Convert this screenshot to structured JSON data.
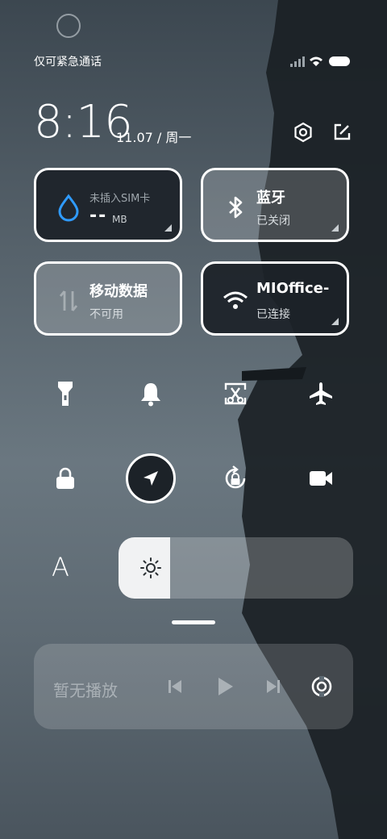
{
  "status_bar": {
    "carrier_text": "仅可紧急通话"
  },
  "header": {
    "time": "8:16",
    "date": "11.07 / 周一"
  },
  "tiles": [
    {
      "title": "未插入SIM卡",
      "value": "--",
      "unit": "MB"
    },
    {
      "title": "蓝牙",
      "subtitle": "已关闭"
    },
    {
      "title": "移动数据",
      "subtitle": "不可用"
    },
    {
      "title": "MIOffice-",
      "subtitle": "已连接"
    }
  ],
  "toggles_row1": [
    "flashlight-icon",
    "bell-icon",
    "screenshot-icon",
    "airplane-icon"
  ],
  "toggles_row2": [
    "lock-icon",
    "location-icon",
    "auto-rotate-icon",
    "video-icon"
  ],
  "brightness": {
    "level": 0.22,
    "font_label": "A"
  },
  "media": {
    "title": "暂无播放"
  },
  "colors": {
    "wifi_accent": "#2f9bff",
    "active_toggle": "#1c2228"
  }
}
